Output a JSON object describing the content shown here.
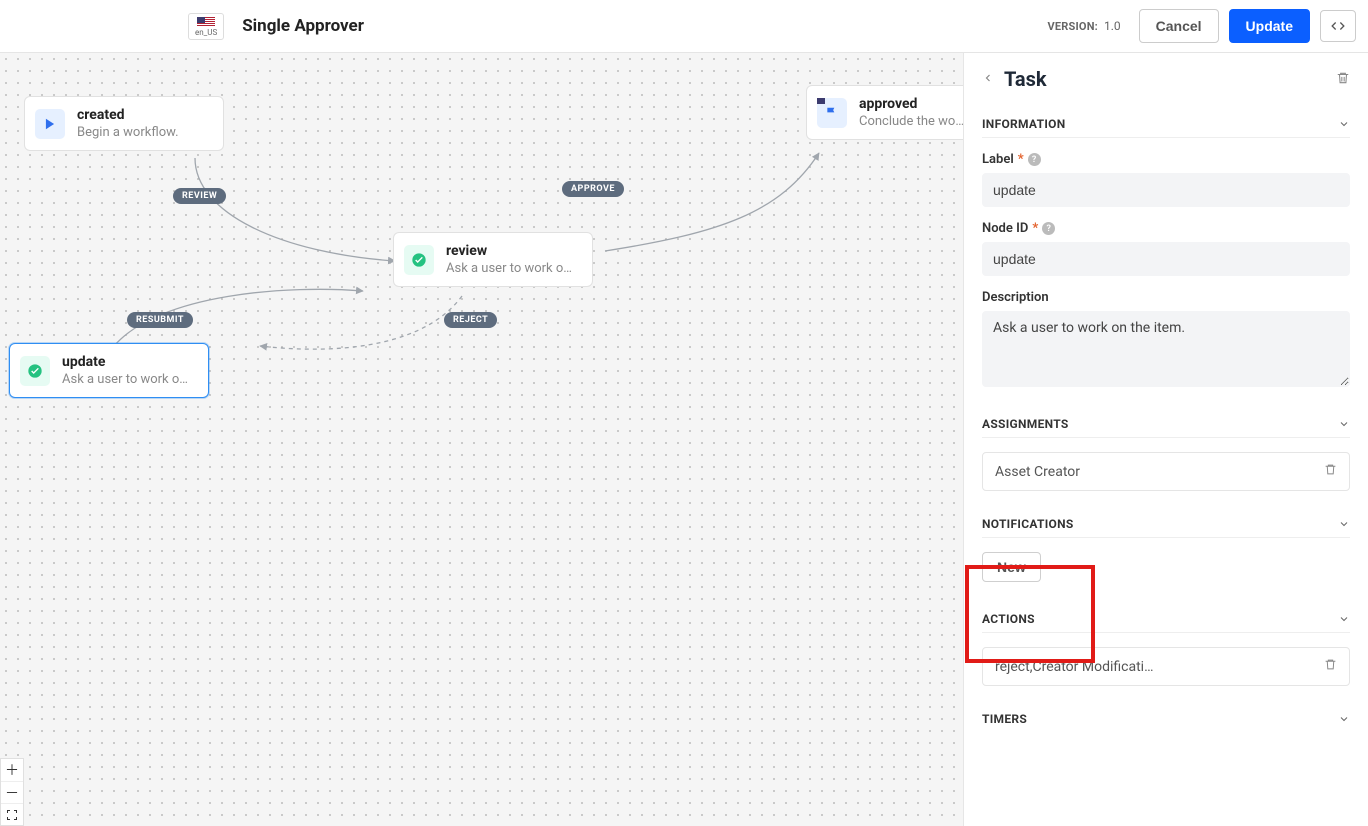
{
  "header": {
    "locale": "en_US",
    "title": "Single Approver",
    "version_label": "VERSION:",
    "version_value": "1.0",
    "cancel": "Cancel",
    "update": "Update"
  },
  "nodes": {
    "created": {
      "title": "created",
      "sub": "Begin a workflow."
    },
    "review": {
      "title": "review",
      "sub": "Ask a user to work o…"
    },
    "update": {
      "title": "update",
      "sub": "Ask a user to work o…"
    },
    "approved": {
      "title": "approved",
      "sub": "Conclude the wo…"
    }
  },
  "pills": {
    "review": "REVIEW",
    "approve": "APPROVE",
    "reject": "REJECT",
    "resubmit": "RESUBMIT"
  },
  "panel": {
    "title": "Task",
    "sections": {
      "information": "INFORMATION",
      "assignments": "ASSIGNMENTS",
      "notifications": "NOTIFICATIONS",
      "actions": "ACTIONS",
      "timers": "TIMERS"
    },
    "fields": {
      "label_label": "Label",
      "label_value": "update",
      "nodeid_label": "Node ID",
      "nodeid_value": "update",
      "description_label": "Description",
      "description_value": "Ask a user to work on the item."
    },
    "assignments_item": "Asset Creator",
    "notifications_new": "New",
    "actions_item": "reject,Creator Modificati…"
  }
}
